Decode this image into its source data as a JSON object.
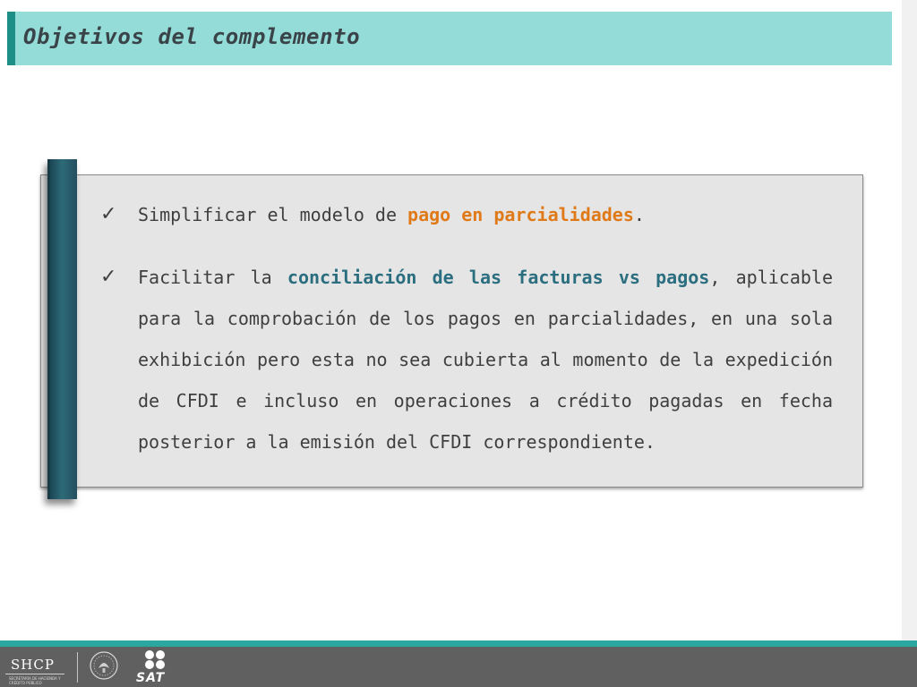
{
  "slide": {
    "title": "Objetivos del complemento"
  },
  "bullets": [
    {
      "parts": [
        {
          "text": "Simplificar el modelo de "
        },
        {
          "text": "pago en parcialidades",
          "highlight": "orange"
        },
        {
          "text": "."
        }
      ]
    },
    {
      "parts": [
        {
          "text": "Facilitar la "
        },
        {
          "text": "conciliación de las facturas vs pagos",
          "highlight": "teal"
        },
        {
          "text": ", aplicable para la comprobación de los pagos en parcialidades, en una sola exhibición pero esta no sea cubierta al momento de la expedición de CFDI e incluso  en operaciones a crédito pagadas en fecha posterior a la emisión del CFDI correspondiente."
        }
      ]
    }
  ],
  "footer": {
    "shcp_label": "SHCP",
    "shcp_subtitle": "SECRETARÍA DE HACIENDA Y CRÉDITO PÚBLICO",
    "sat_label": "SAT"
  },
  "colors": {
    "title_bar": "#93dcd8",
    "title_accent": "#1e8f87",
    "highlight_orange": "#e07a18",
    "highlight_teal": "#2b6e7f",
    "side_bar": "#2d6a78",
    "footer_line": "#2aa89f",
    "footer_bg": "#606060"
  },
  "icons": {
    "bullet": "checkmark-icon",
    "footer_seal": "mexico-coat-of-arms-icon",
    "footer_sat": "sat-logo-icon"
  }
}
